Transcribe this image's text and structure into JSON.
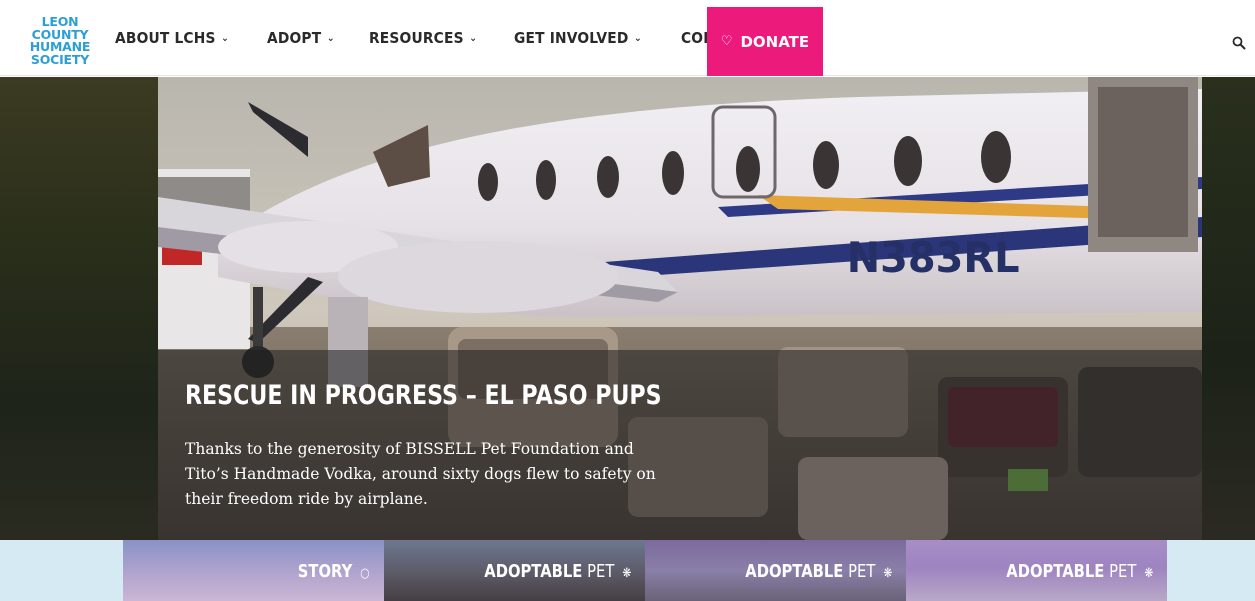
{
  "logo": {
    "lines": [
      "LEON",
      "COUNTY",
      "HUMANE",
      "SOCIETY"
    ]
  },
  "nav": {
    "items": [
      {
        "label": "ABOUT LCHS"
      },
      {
        "label": "ADOPT"
      },
      {
        "label": "RESOURCES"
      },
      {
        "label": "GET INVOLVED"
      },
      {
        "label": "CONTACT"
      }
    ],
    "donate_label": "DONATE"
  },
  "hero": {
    "title": "RESCUE IN PROGRESS – EL PASO PUPS",
    "text": "Thanks to the generosity of BISSELL Pet Foundation and Tito’s Handmade Vodka, around sixty dogs flew to safety on their freedom ride by airplane.",
    "plane_registration": "N383RL"
  },
  "tiles": [
    {
      "bold": "STORY",
      "thin": "",
      "icon": "speech-bubble-icon"
    },
    {
      "bold": "ADOPTABLE",
      "thin": "PET",
      "icon": "paw-icon"
    },
    {
      "bold": "ADOPTABLE",
      "thin": "PET",
      "icon": "paw-icon"
    },
    {
      "bold": "ADOPTABLE",
      "thin": "PET",
      "icon": "paw-icon"
    }
  ],
  "colors": {
    "brand_blue": "#2b9fd6",
    "donate_pink": "#ec1a7a",
    "nav_text": "#2a2a2a"
  }
}
